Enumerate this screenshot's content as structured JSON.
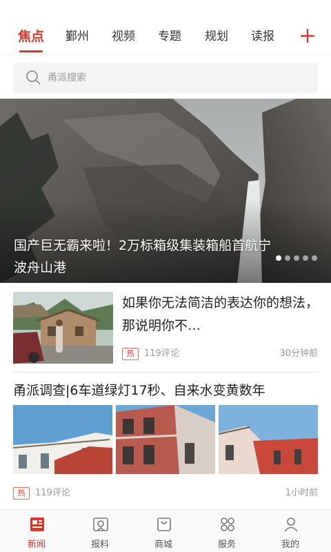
{
  "tabs": {
    "items": [
      {
        "label": "焦点",
        "active": true
      },
      {
        "label": "鄞州",
        "active": false
      },
      {
        "label": "视频",
        "active": false
      },
      {
        "label": "专题",
        "active": false
      },
      {
        "label": "规划",
        "active": false
      },
      {
        "label": "读报",
        "active": false
      }
    ],
    "add_icon": "plus-icon"
  },
  "search": {
    "placeholder": "甬派搜索",
    "value": "",
    "icon": "search-icon"
  },
  "banner": {
    "title": "国产巨无霸来啦！2万标箱级集装箱船首航宁波舟山港",
    "slides_total": 5,
    "active_slide": 1
  },
  "news": [
    {
      "title": "如果你无法简洁的表达你的想法，那说明你不…",
      "hot_badge": "热",
      "comments": "119评论",
      "time": "30分钟前"
    },
    {
      "title": "甬派调查|6车道绿灯17秒、自来水变黄数年",
      "hot_badge": "热",
      "comments": "119评论",
      "time": "1小时前"
    }
  ],
  "bottom_nav": [
    {
      "label": "新闻",
      "icon": "news-icon",
      "active": true
    },
    {
      "label": "报料",
      "icon": "report-icon",
      "active": false
    },
    {
      "label": "商城",
      "icon": "shop-icon",
      "active": false
    },
    {
      "label": "服务",
      "icon": "service-icon",
      "active": false
    },
    {
      "label": "我的",
      "icon": "profile-icon",
      "active": false
    }
  ],
  "colors": {
    "accent": "#d9352b",
    "text": "#222222",
    "muted": "#999999"
  }
}
